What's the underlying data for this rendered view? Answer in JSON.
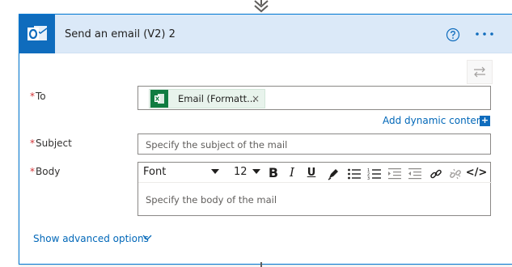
{
  "action": {
    "title": "Send an email (V2) 2",
    "logo_icon": "outlook-icon",
    "help_icon": "help-circle-icon",
    "more_icon": "more-options-icon",
    "swap_icon": "swap-arrows-icon"
  },
  "fields": {
    "to": {
      "required_mark": "*",
      "label": "To",
      "token_text": "Email (Formatt...",
      "token_icon": "excel-icon",
      "token_close": "×"
    },
    "add_dynamic": "Add dynamic content",
    "add_dynamic_plus": "+",
    "subject": {
      "required_mark": "*",
      "label": "Subject",
      "placeholder": "Specify the subject of the mail"
    },
    "body": {
      "required_mark": "*",
      "label": "Body",
      "placeholder": "Specify the body of the mail",
      "font": "Font",
      "size": "12",
      "bold": "B",
      "italic": "I",
      "underline": "U",
      "code_view": "</>"
    }
  },
  "advanced": {
    "label": "Show advanced options"
  },
  "colors": {
    "accent": "#0078d4",
    "header_bg": "#dbe9f8",
    "required": "#d13438",
    "link": "#0067b8",
    "excel": "#107c41"
  }
}
